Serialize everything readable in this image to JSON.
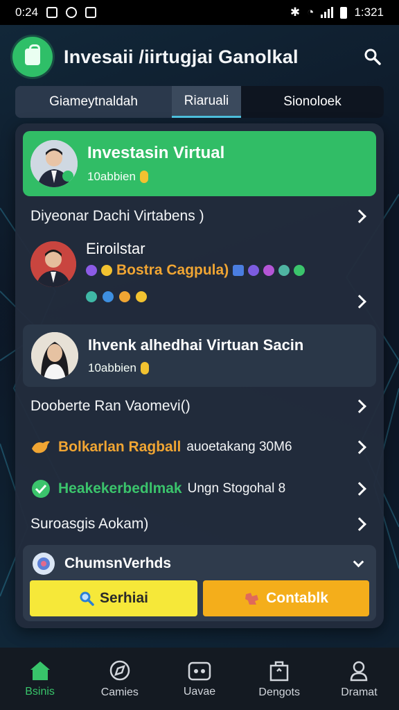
{
  "status_bar": {
    "time": "0:24",
    "right_time": "1:321"
  },
  "header": {
    "title": "Invesaii /iirtugjai Ganolkal"
  },
  "tabs": [
    {
      "label": "Giameytnaldah"
    },
    {
      "label": "Riaruali"
    },
    {
      "label": "Sionoloek"
    }
  ],
  "featured": {
    "title": "Investasin Virtual",
    "subtitle": "10abbien"
  },
  "row1": {
    "label": "Diyeonar Dachi Virtabens )"
  },
  "profile2": {
    "name": "Eiroilstar",
    "tag_label": "Bostra Cagpula)"
  },
  "member": {
    "title": "Ihvenk alhedhai Virtuan Sacin",
    "subtitle": "10abbien"
  },
  "row2": {
    "label": "Dooberte Ran Vaomevi()"
  },
  "row3": {
    "colored": "Bolkarlan Ragball",
    "rest": "auoetakang 30M6",
    "color": "#f0a533"
  },
  "row4": {
    "colored": "Heakekerbedlmak",
    "rest": "Ungn Stogohal 8",
    "color": "#3bc46c"
  },
  "row5": {
    "label": "Suroasgis Aokam)"
  },
  "dropdown": {
    "label": "ChumsnVerhds",
    "search_label": "Serhiai",
    "contact_label": "Contablk"
  },
  "bottom_nav": [
    {
      "label": "Bsinis",
      "icon": "home-icon",
      "active": true
    },
    {
      "label": "Camies",
      "icon": "compass-icon",
      "active": false
    },
    {
      "label": "Uavae",
      "icon": "wallet-icon",
      "active": false
    },
    {
      "label": "Dengots",
      "icon": "bag-icon",
      "active": false
    },
    {
      "label": "Dramat",
      "icon": "profile-icon",
      "active": false
    }
  ],
  "colors": {
    "accent": "#31bd66",
    "button_yellow": "#f6e839",
    "button_orange": "#f4ae1b"
  }
}
